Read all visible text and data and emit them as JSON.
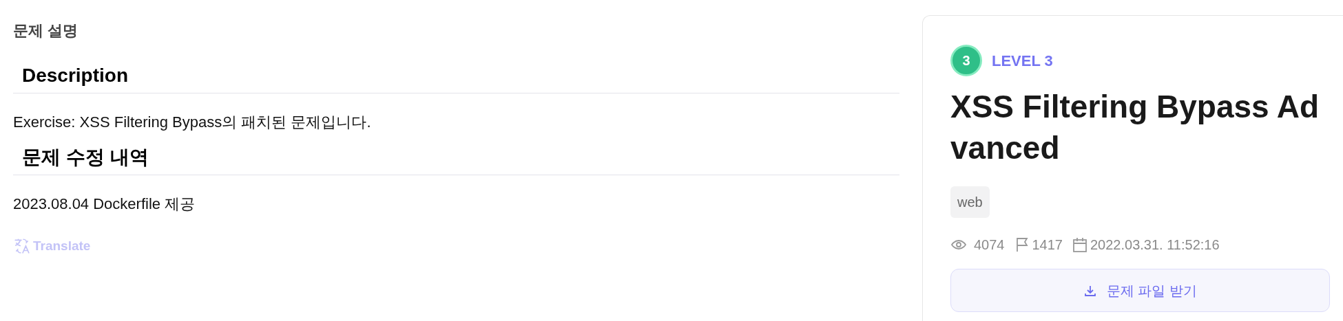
{
  "section_title": "문제 설명",
  "sections": [
    {
      "heading": "Description",
      "body": "Exercise: XSS Filtering Bypass의 패치된 문제입니다."
    },
    {
      "heading": "문제 수정 내역",
      "body": "2023.08.04 Dockerfile 제공"
    }
  ],
  "translate_link": "Translate",
  "card": {
    "level_badge": "3",
    "level_label": "LEVEL 3",
    "title": "XSS Filtering Bypass Advanced",
    "tags": [
      "web"
    ],
    "stats": {
      "views": "4074",
      "solves": "1417",
      "date": "2022.03.31. 11:52:16"
    },
    "download_button": "문제 파일 받기"
  }
}
